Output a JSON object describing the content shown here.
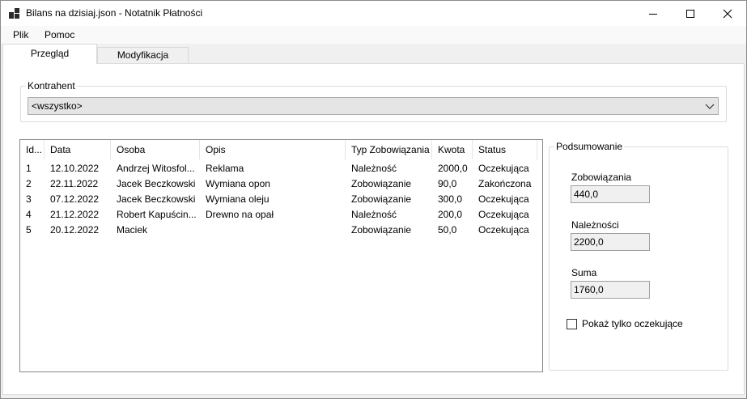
{
  "window": {
    "title": "Bilans na dzisiaj.json - Notatnik Płatności"
  },
  "menu": {
    "items": [
      {
        "label": "Plik"
      },
      {
        "label": "Pomoc"
      }
    ]
  },
  "tabs": [
    {
      "label": "Przegląd",
      "active": true
    },
    {
      "label": "Modyfikacja",
      "active": false
    }
  ],
  "contractor": {
    "group_label": "Kontrahent",
    "selected": "<wszystko>"
  },
  "table": {
    "columns": [
      "Id...",
      "Data",
      "Osoba",
      "Opis",
      "Typ Zobowiązania",
      "Kwota",
      "Status"
    ],
    "rows": [
      [
        "1",
        "12.10.2022",
        "Andrzej Witosfol...",
        "Reklama",
        "Należność",
        "2000,0",
        "Oczekująca"
      ],
      [
        "2",
        "22.11.2022",
        "Jacek Beczkowski",
        "Wymiana opon",
        "Zobowiązanie",
        "90,0",
        "Zakończona"
      ],
      [
        "3",
        "07.12.2022",
        "Jacek Beczkowski",
        "Wymiana oleju",
        "Zobowiązanie",
        "300,0",
        "Oczekująca"
      ],
      [
        "4",
        "21.12.2022",
        "Robert Kapuścin...",
        "Drewno na opał",
        "Należność",
        "200,0",
        "Oczekująca"
      ],
      [
        "5",
        "20.12.2022",
        "Maciek",
        "",
        "Zobowiązanie",
        "50,0",
        "Oczekująca"
      ]
    ]
  },
  "summary": {
    "group_label": "Podsumowanie",
    "liabilities_label": "Zobowiązania",
    "liabilities_value": "440,0",
    "receivables_label": "Należności",
    "receivables_value": "2200,0",
    "sum_label": "Suma",
    "sum_value": "1760,0",
    "pending_only_label": "Pokaż tylko oczekujące",
    "pending_only_checked": false
  }
}
